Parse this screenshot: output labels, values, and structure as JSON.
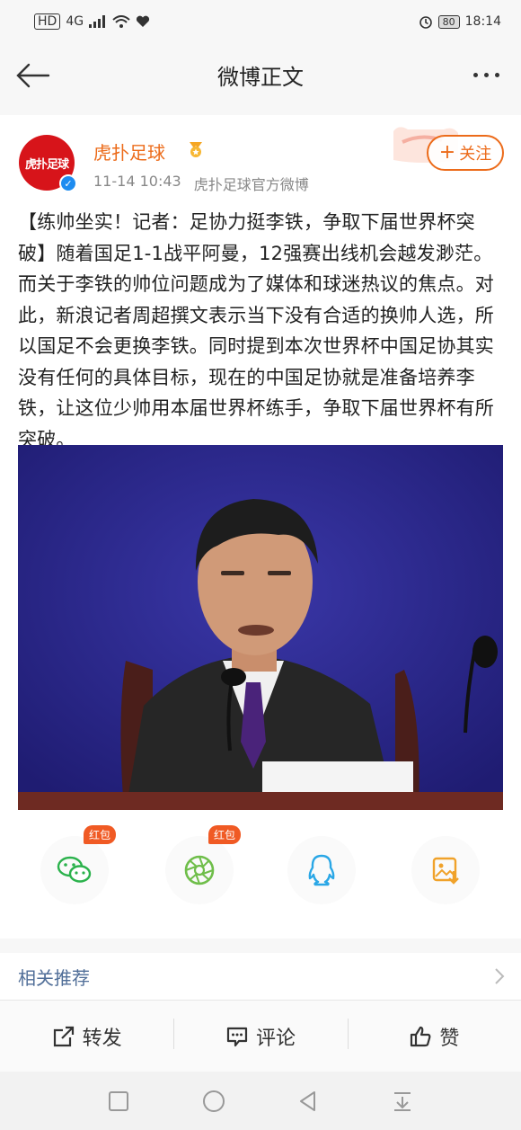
{
  "status_bar": {
    "hd": "HD",
    "network": "4G",
    "battery": "80",
    "time": "18:14"
  },
  "header": {
    "title": "微博正文"
  },
  "post": {
    "avatar_text": "虎扑足球",
    "author": "虎扑足球",
    "time": "11-14 10:43",
    "source": "虎扑足球官方微博",
    "follow_label": "关注",
    "content": "【练帅坐实！记者：足协力挺李铁，争取下届世界杯突破】随着国足1-1战平阿曼，12强赛出线机会越发渺茫。而关于李铁的帅位问题成为了媒体和球迷热议的焦点。对此，新浪记者周超撰文表示当下没有合适的换帅人选，所以国足不会更换李铁。同时提到本次世界杯中国足协其实没有任何的具体目标，现在的中国足协就是准备培养李铁，让这位少帅用本届世界杯练手，争取下届世界杯有所突破。"
  },
  "share": {
    "badge_label": "红包",
    "items": [
      {
        "icon": "wechat-icon"
      },
      {
        "icon": "moments-icon"
      },
      {
        "icon": "qq-icon"
      },
      {
        "icon": "save-image-icon"
      }
    ]
  },
  "related": {
    "label": "相关推荐"
  },
  "actions": {
    "repost": "转发",
    "comment": "评论",
    "like": "赞"
  },
  "colors": {
    "accent": "#ec6b1a",
    "link": "#506e98",
    "badge": "#f05a24"
  }
}
